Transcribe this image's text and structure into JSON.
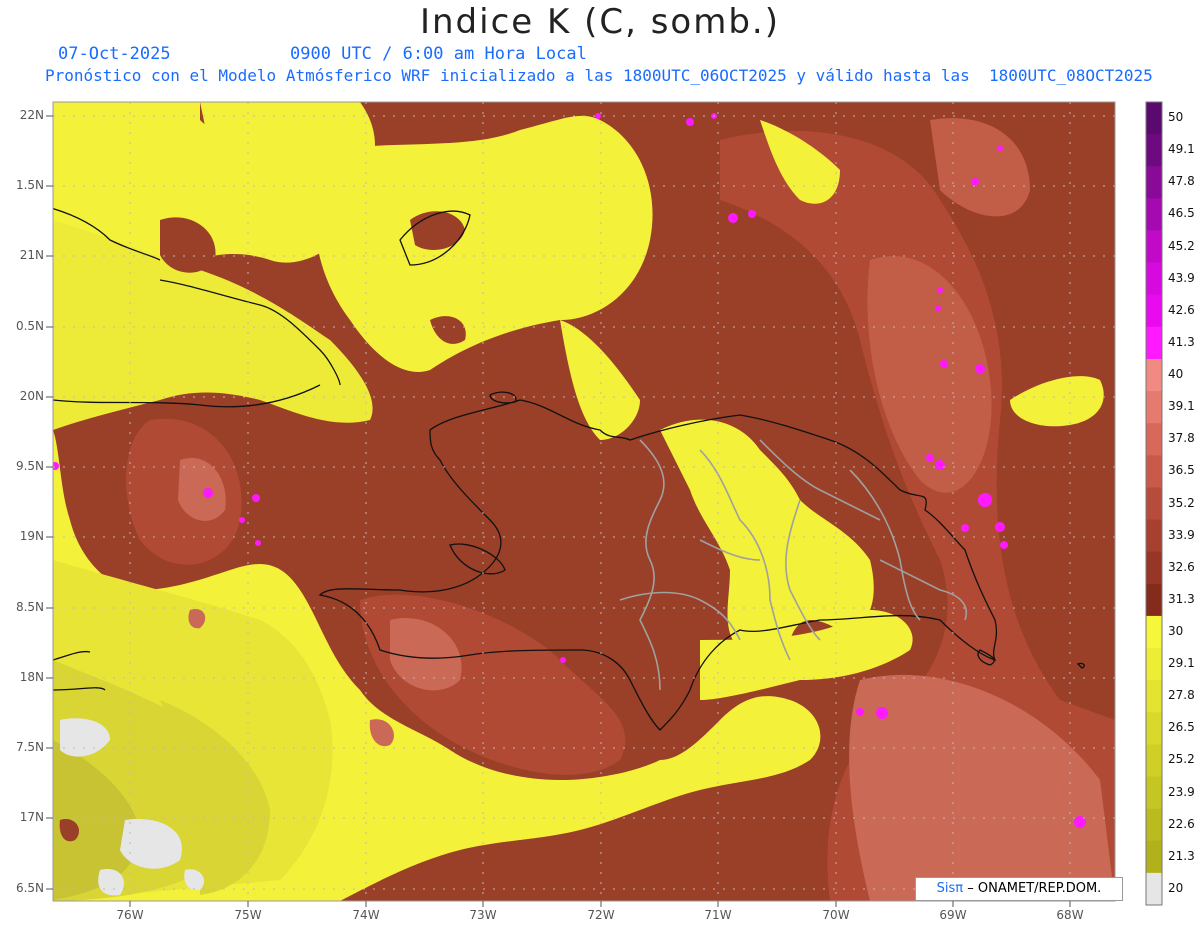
{
  "header": {
    "title": "Indice K (C, somb.)",
    "date": "07-Oct-2025",
    "time": "0900 UTC / 6:00 am Hora Local",
    "subtitle": "Pronóstico con el Modelo Atmósferico WRF inicializado a las 1800UTC_06OCT2025 y válido hasta las  1800UTC_08OCT2025"
  },
  "map": {
    "lat_labels": [
      "22N",
      "1.5N",
      "21N",
      "0.5N",
      "20N",
      "9.5N",
      "19N",
      "8.5N",
      "18N",
      "7.5N",
      "17N",
      "6.5N"
    ],
    "lon_labels": [
      "76W",
      "75W",
      "74W",
      "73W",
      "72W",
      "71W",
      "70W",
      "69W",
      "68W"
    ],
    "colors": {
      "yellow": "#f4f13a",
      "yellow_green": "#d8d535",
      "olive": "#bdb830",
      "brown": "#9a3f28",
      "brown_light": "#c15a47",
      "salmon": "#d77664",
      "magenta": "#ff19ff",
      "no_data": "#e6e6e6",
      "coast": "#111111",
      "provinces": "#a0a0a0"
    }
  },
  "colorbar": {
    "levels": [
      "50",
      "49.1",
      "47.8",
      "46.5",
      "45.2",
      "43.9",
      "42.6",
      "41.3",
      "40",
      "39.1",
      "37.8",
      "36.5",
      "35.2",
      "33.9",
      "32.6",
      "31.3",
      "30",
      "29.1",
      "27.8",
      "26.5",
      "25.2",
      "23.9",
      "22.6",
      "21.3",
      "20"
    ],
    "colors": [
      "#5a0a6e",
      "#6e0a80",
      "#8a0a98",
      "#a40ab0",
      "#c00ac8",
      "#d60ade",
      "#ea0af0",
      "#ff19ff",
      "#f28a84",
      "#e67a6e",
      "#d8695a",
      "#c95a4a",
      "#b84c3c",
      "#a84030",
      "#973626",
      "#852b1c",
      "#f6f63a",
      "#eded35",
      "#e3e330",
      "#d9d92c",
      "#cfcf28",
      "#c5c524",
      "#bbbb20",
      "#b1b11c",
      "#e6e6e6"
    ]
  },
  "credit": {
    "brand": "Sisπ",
    "text": "– ONAMET/REP.DOM."
  }
}
